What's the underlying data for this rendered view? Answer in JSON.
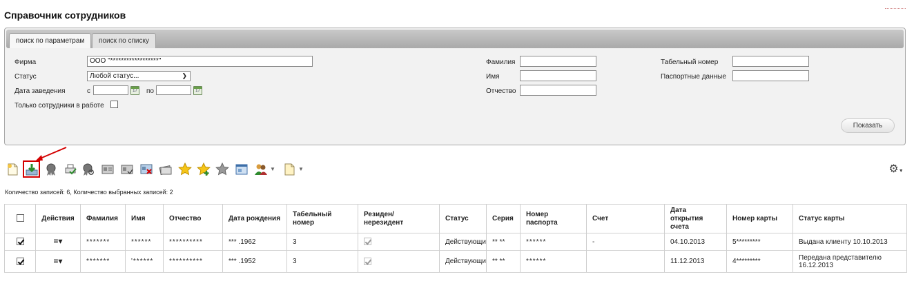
{
  "page": {
    "title": "Справочник сотрудников"
  },
  "tabs": [
    {
      "label": "поиск по параметрам",
      "active": true
    },
    {
      "label": "поиск по списку",
      "active": false
    }
  ],
  "form": {
    "firm_label": "Фирма",
    "firm_value": "ООО \"******************\"",
    "status_label": "Статус",
    "status_value": "Любой статус...",
    "date_label": "Дата заведения",
    "from_label": "с",
    "from_value": "",
    "to_label": "по",
    "to_value": "",
    "calendar_day": "17",
    "active_only_label": "Только сотрудники в работе",
    "surname_label": "Фамилия",
    "name_label": "Имя",
    "patronymic_label": "Отчество",
    "tab_number_label": "Табельный номер",
    "passport_label": "Паспортные данные",
    "show_button": "Показать"
  },
  "toolbar": {
    "icons": [
      "new-document-icon",
      "export-icon",
      "award-icon",
      "print-icon",
      "award-check-icon",
      "card-icon",
      "card-list-icon",
      "card-delete-icon",
      "card-stack-icon",
      "star-icon",
      "star-add-icon",
      "star-gray-icon",
      "window-icon",
      "users-icon",
      "document-icon",
      "settings-icon"
    ],
    "accent": "#d40000"
  },
  "records_info": "Количество записей: 6, Количество выбранных записей: 2",
  "table": {
    "headers": {
      "actions": "Действия",
      "surname": "Фамилия",
      "name": "Имя",
      "patronymic": "Отчество",
      "birth_date": "Дата рождения",
      "tab_number": "Табельный номер",
      "resident": "Резиден/нерезидент",
      "status": "Статус",
      "series": "Серия",
      "passport": "Номер паспорта",
      "account": "Счет",
      "open_date": "Дата открытия счета",
      "card_number": "Номер карты",
      "card_status": "Статус карты"
    },
    "rows": [
      {
        "surname": "*******",
        "name": "******",
        "patronymic": "**********",
        "birth_date": "*** .1962",
        "tab_number": "3",
        "status": "Действующий",
        "series": "** **",
        "passport": "******",
        "account": "-",
        "open_date": "04.10.2013",
        "card_number": "5*********",
        "card_status": "Выдана клиенту 10.10.2013"
      },
      {
        "surname": "*******",
        "name": "'******",
        "patronymic": "**********",
        "birth_date": "*** .1952",
        "tab_number": "3",
        "status": "Действующий",
        "series": "** **",
        "passport": "******",
        "account": "",
        "open_date": "11.12.2013",
        "card_number": "4*********",
        "card_status": "Передана представителю 16.12.2013"
      }
    ]
  }
}
